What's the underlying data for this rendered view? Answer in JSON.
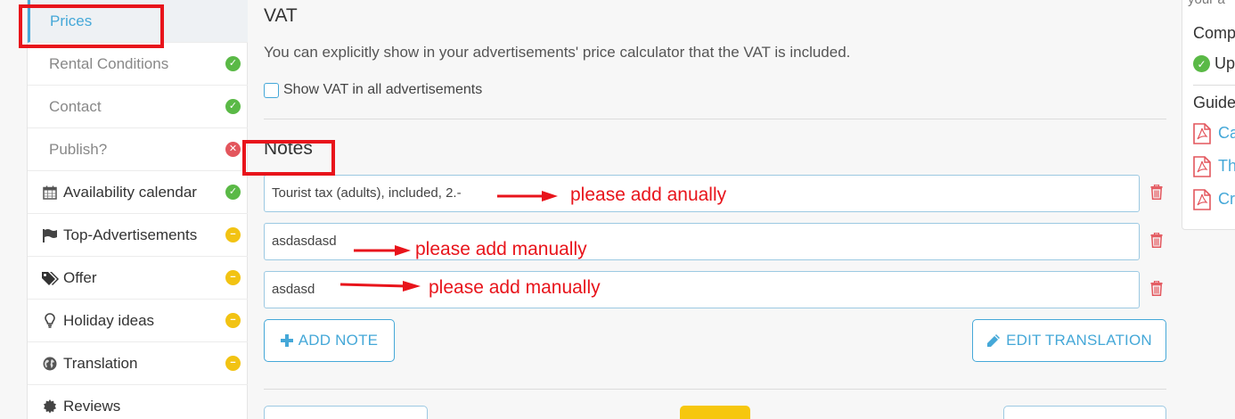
{
  "sidebar": {
    "items": [
      {
        "label": "Prices",
        "status": ""
      },
      {
        "label": "Rental Conditions",
        "status": "ok"
      },
      {
        "label": "Contact",
        "status": "ok"
      },
      {
        "label": "Publish?",
        "status": "error"
      },
      {
        "label": "Availability calendar",
        "icon": "calendar-icon",
        "status": "ok"
      },
      {
        "label": "Top-Advertisements",
        "icon": "flag-icon",
        "status": "warning"
      },
      {
        "label": "Offer",
        "icon": "tags-icon",
        "status": "warning"
      },
      {
        "label": "Holiday ideas",
        "icon": "lightbulb-icon",
        "status": "warning"
      },
      {
        "label": "Translation",
        "icon": "globe-icon",
        "status": "warning"
      },
      {
        "label": "Reviews",
        "icon": "badge-icon",
        "status": ""
      }
    ]
  },
  "vat": {
    "title": "VAT",
    "description": "You can explicitly show in your advertisements' price calculator that the VAT is included.",
    "checkbox_label": "Show VAT in all advertisements",
    "checkbox_checked": false
  },
  "notes": {
    "title": "Notes",
    "items": [
      {
        "value": "Tourist tax (adults), included, 2.-"
      },
      {
        "value": "asdasdasd"
      },
      {
        "value": "asdasd"
      }
    ],
    "add_note_label": "ADD NOTE",
    "edit_translation_label": "EDIT TRANSLATION"
  },
  "annotations": {
    "note1": "please add anually",
    "note2": "please add manually",
    "note3": "please add manually"
  },
  "right_panel": {
    "top_fragment": "your a",
    "completeness_label": "Comp",
    "status_label": "Up",
    "guides_label": "Guide",
    "links": [
      "Ca",
      "Th",
      "Cr"
    ]
  },
  "colors": {
    "accent": "#45a8d8",
    "ok": "#5ab946",
    "error": "#e3565d",
    "warning": "#f2c313",
    "annotation": "#e8141b",
    "pdf": "#e3565d"
  }
}
